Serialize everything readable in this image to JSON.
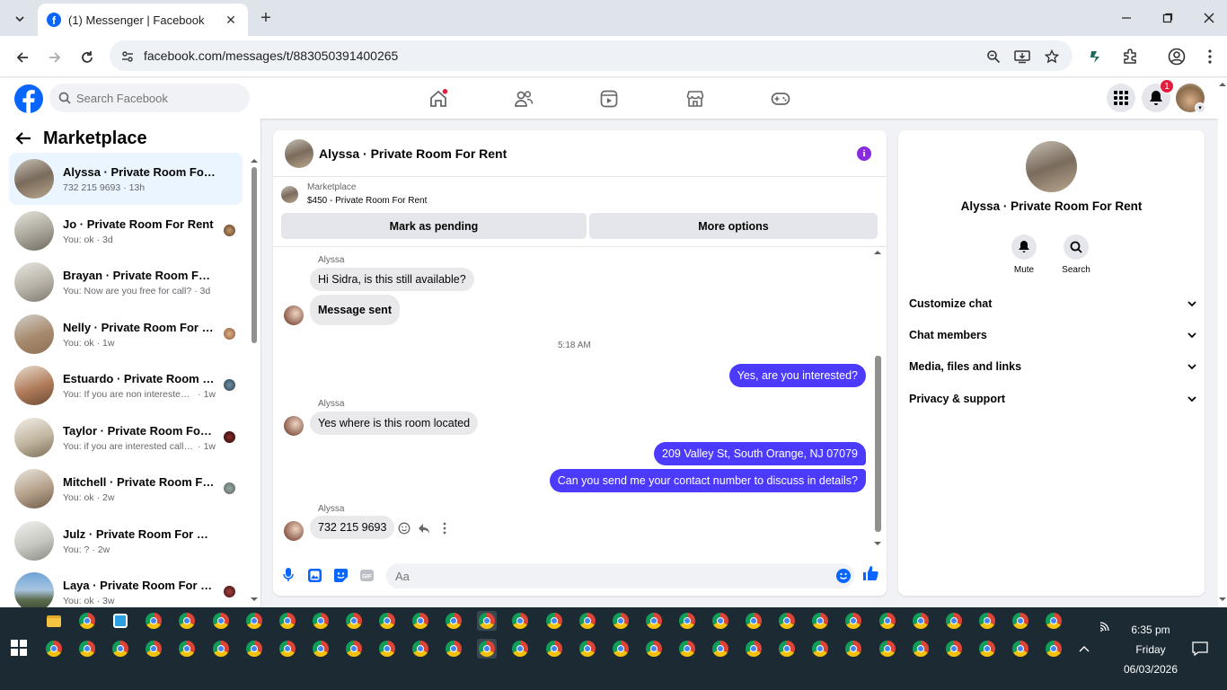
{
  "browser": {
    "tab_title": "(1) Messenger | Facebook",
    "url": "facebook.com/messages/t/883050391400265"
  },
  "fb": {
    "search_placeholder": "Search Facebook",
    "notification_count": "1",
    "brand_color": "#0866ff"
  },
  "sidebar": {
    "title": "Marketplace",
    "conversations": [
      {
        "name": "Alyssa · Private Room For Rent",
        "preview": "732 215 9693",
        "time": "13h",
        "active": true
      },
      {
        "name": "Jo · Private Room For Rent",
        "preview": "You: ok",
        "time": "3d"
      },
      {
        "name": "Brayan · Private Room For Rent",
        "preview": "You: Now are you free for call?",
        "time": "3d"
      },
      {
        "name": "Nelly · Private Room For Rent",
        "preview": "You: ok",
        "time": "1w"
      },
      {
        "name": "Estuardo · Private Room For ...",
        "preview": "You: If you are non interested t...",
        "time": "1w"
      },
      {
        "name": "Taylor · Private Room For Rent",
        "preview": "You: if you are interested call m...",
        "time": "1w"
      },
      {
        "name": "Mitchell · Private Room For R...",
        "preview": "You: ok",
        "time": "2w"
      },
      {
        "name": "Julz · Private Room For Rent",
        "preview": "You: ?",
        "time": "2w"
      },
      {
        "name": "Laya · Private Room For Rent",
        "preview": "You: ok",
        "time": "3w"
      }
    ]
  },
  "chat": {
    "title": "Alyssa · Private Room For Rent",
    "marketplace_label": "Marketplace",
    "listing": "$450 - Private Room For Rent",
    "mark_pending": "Mark as pending",
    "more_options": "More options",
    "sender_name": "Alyssa",
    "messages": {
      "m1": "Hi Sidra, is this still available?",
      "m2": "Message sent",
      "timestamp": "5:18 AM",
      "m3": "Yes, are you interested?",
      "m4": "Yes where is this room located",
      "m5": "209 Valley St, South Orange, NJ 07079",
      "m6": "Can you send me your contact number to discuss in details?",
      "m7": "732 215 9693"
    },
    "composer_placeholder": "Aa",
    "outgoing_color": "#4c3bff"
  },
  "info": {
    "name": "Alyssa · Private Room For Rent",
    "mute": "Mute",
    "search": "Search",
    "sections": [
      "Customize chat",
      "Chat members",
      "Media, files and links",
      "Privacy & support"
    ]
  },
  "taskbar": {
    "time": "6:35 pm",
    "day": "Friday",
    "date": "06/03/2026"
  }
}
